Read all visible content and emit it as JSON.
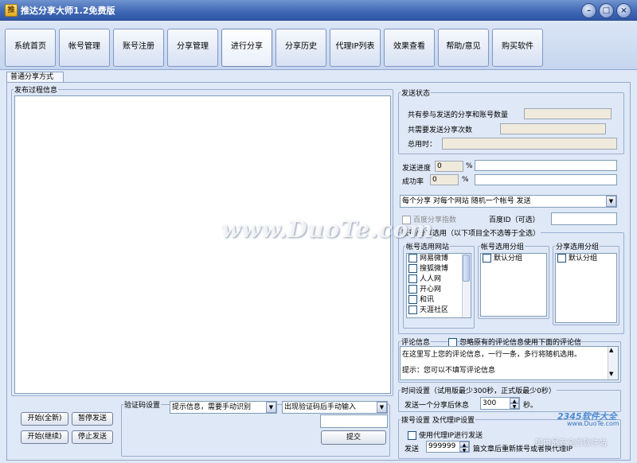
{
  "window": {
    "title": "推达分享大师1.2免费版",
    "icon_glyph": "推"
  },
  "tabs": [
    "系统首页",
    "帐号管理",
    "账号注册",
    "分享管理",
    "进行分享",
    "分享历史",
    "代理IP列表",
    "效果查看",
    "帮助/意见",
    "购买软件"
  ],
  "subtab": "普通分享方式",
  "log_panel": {
    "legend": "发布过程信息"
  },
  "status": {
    "legend": "发送状态",
    "total_label": "共有参与发送的分享和账号数量",
    "send_count_label": "共需要发送分享次数",
    "elapsed_label": "总用时：",
    "progress_label": "发送进度",
    "progress_value": "0",
    "progress_pct": "%",
    "success_label": "成功率",
    "success_value": "0",
    "success_pct": "%"
  },
  "mode_dropdown": {
    "value": "每个分享 对每个网站 随机一个帐号 发送"
  },
  "baidu": {
    "index_label": "百度分享指数",
    "id_label": "百度ID（可选）"
  },
  "account_select": {
    "legend": "账号/分享选用（以下项目全不选等于全选）",
    "sites": {
      "legend": "帐号选用网站",
      "items": [
        "网易微博",
        "搜狐微博",
        "人人网",
        "开心网",
        "和讯",
        "天涯社区"
      ]
    },
    "account_groups": {
      "legend": "帐号选用分组",
      "items": [
        "默认分组"
      ]
    },
    "share_groups": {
      "legend": "分享选用分组",
      "items": [
        "默认分组"
      ]
    }
  },
  "comment": {
    "legend": "评论信息",
    "ignore_label": "忽略原有的评论信息使用下面的评论信",
    "text_line1": "在这里写上您的评论信息，一行一条，多行将随机选用。",
    "text_line2": "提示：您可以不填写评论信息"
  },
  "time_settings": {
    "legend": "时间设置（试用版最少300秒，正式版最少0秒）",
    "rest_label": "发送一个分享后休息",
    "rest_value": "300",
    "unit": "秒。"
  },
  "proxy": {
    "legend": "拨号设置 及代理IP设置",
    "use_proxy_label": "使用代理IP进行发送",
    "send_label": "发送",
    "count_value": "999999",
    "after_label": "篇文章后重新拨号或者换代理IP"
  },
  "buttons": {
    "start_new": "开始(全新)",
    "pause": "暂停发送",
    "start_continue": "开始(继续)",
    "stop": "停止发送",
    "submit": "提交"
  },
  "captcha": {
    "legend": "验证码设置",
    "mode_value": "提示信息，需要手动识别",
    "when_value": "出现验证码后手动输入"
  },
  "watermarks": {
    "main": "www.DuoTe.com",
    "brand": "2345软件大全",
    "brand_url": "www.DuoTe.com",
    "brand_sub": "国内最安全的软件站"
  }
}
